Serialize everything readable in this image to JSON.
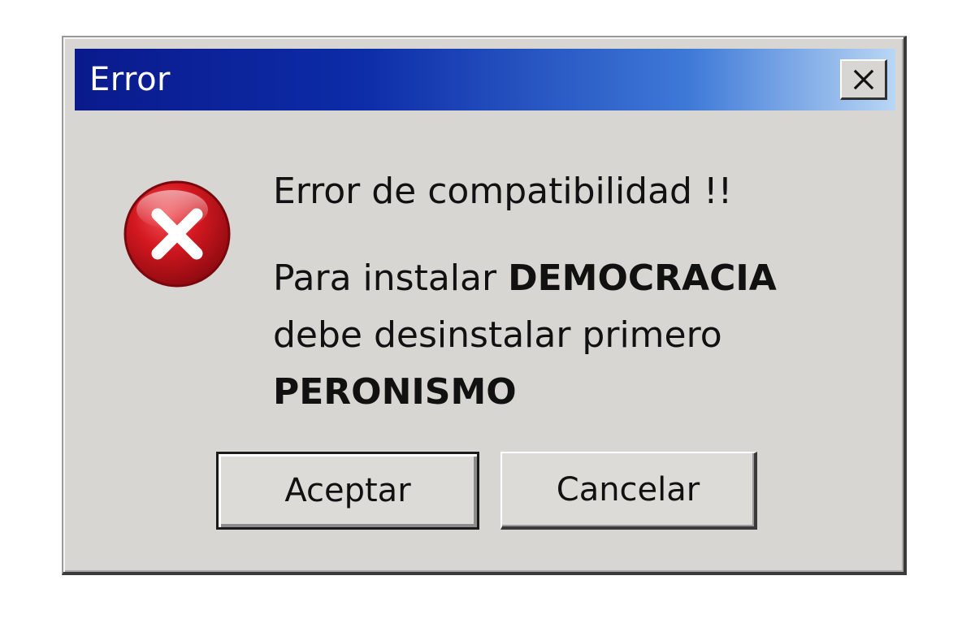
{
  "window": {
    "title": "Error",
    "close_icon": "close-icon",
    "colors": {
      "titlebar_start": "#0a1a8c",
      "titlebar_end": "#b9d6f4",
      "dialog_bg": "#d7d6d3",
      "error_icon": "#c8101a"
    }
  },
  "message": {
    "icon": "error-icon",
    "headline": "Error de compatibilidad !!",
    "line1_prefix": "Para instalar ",
    "line1_bold": "DEMOCRACIA",
    "line2": "debe desinstalar primero",
    "line3_bold": "PERONISMO"
  },
  "buttons": {
    "accept_label": "Aceptar",
    "cancel_label": "Cancelar"
  }
}
